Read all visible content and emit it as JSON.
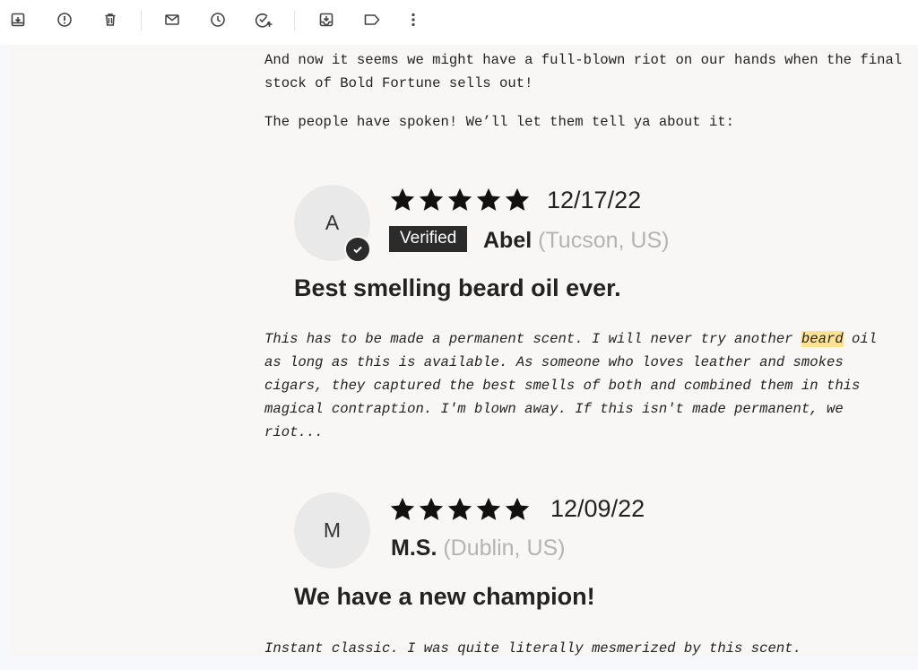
{
  "toolbar": {
    "buttons": [
      {
        "id": "archive",
        "icon": "archive-icon"
      },
      {
        "id": "report-spam",
        "icon": "report-spam-icon"
      },
      {
        "id": "delete",
        "icon": "trash-icon"
      },
      {
        "id": "mark-unread",
        "icon": "mail-icon"
      },
      {
        "id": "snooze",
        "icon": "clock-icon"
      },
      {
        "id": "add-task",
        "icon": "add-task-icon"
      },
      {
        "id": "move-to",
        "icon": "move-to-inbox-icon"
      },
      {
        "id": "labels",
        "icon": "label-icon"
      },
      {
        "id": "more",
        "icon": "more-vert-icon"
      }
    ]
  },
  "email": {
    "intro_1": "And now it seems we might have a full-blown riot on our hands when the final stock of Bold Fortune sells out!",
    "intro_2": "The people have spoken! We’ll let them tell ya about it:",
    "reviews": [
      {
        "initial": "A",
        "rating": 5,
        "date": "12/17/22",
        "verified_label": "Verified",
        "author": "Abel",
        "location": "(Tucson, US)",
        "title": "Best smelling beard oil ever.",
        "body_before": "This has to be made a permanent scent. I will never try another ",
        "body_highlight": "beard",
        "body_after": " oil as long as this is available. As someone who loves leather and smokes cigars, they captured the best smells of both and combined them in this magical contraption. I'm blown away. If this isn't made permanent, we riot..."
      },
      {
        "initial": "M",
        "rating": 5,
        "date": "12/09/22",
        "author": "M.S.",
        "location": "(Dublin, US)",
        "title": "We have a new champion!",
        "body": "Instant classic. I was quite literally mesmerized by this scent."
      }
    ]
  },
  "colors": {
    "highlight": "#fde293",
    "star": "#111111",
    "badge_bg": "#2b2b2b",
    "location_gray": "#b3b3b3"
  }
}
